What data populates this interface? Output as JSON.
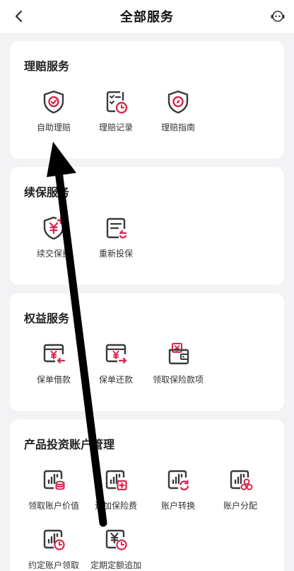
{
  "header": {
    "title": "全部服务"
  },
  "colors": {
    "accent": "#d7264f",
    "icon_dark": "#3a3a3a"
  },
  "sections": [
    {
      "title": "理赔服务",
      "items": [
        {
          "label": "自助理赔",
          "icon": "shield-check-icon"
        },
        {
          "label": "理赔记录",
          "icon": "checklist-clock-icon"
        },
        {
          "label": "理赔指南",
          "icon": "shield-compass-icon"
        }
      ]
    },
    {
      "title": "续保服务",
      "items": [
        {
          "label": "续交保费",
          "icon": "shield-yuan-plus-icon"
        },
        {
          "label": "重新投保",
          "icon": "document-refresh-icon"
        }
      ]
    },
    {
      "title": "权益服务",
      "items": [
        {
          "label": "保单借款",
          "icon": "card-yuan-arrow-in-icon"
        },
        {
          "label": "保单还款",
          "icon": "card-yuan-arrow-out-icon"
        },
        {
          "label": "领取保险款项",
          "icon": "wallet-yuan-icon"
        }
      ]
    },
    {
      "title": "产品投资账户管理",
      "items": [
        {
          "label": "领取账户价值",
          "icon": "chart-coins-icon"
        },
        {
          "label": "追加保险费",
          "icon": "chart-add-icon"
        },
        {
          "label": "账户转换",
          "icon": "chart-switch-icon"
        },
        {
          "label": "账户分配",
          "icon": "chart-distribute-icon"
        },
        {
          "label": "约定账户领取",
          "icon": "chart-clock-icon"
        },
        {
          "label": "定期定额追加",
          "icon": "yuan-clock-icon"
        }
      ]
    }
  ]
}
